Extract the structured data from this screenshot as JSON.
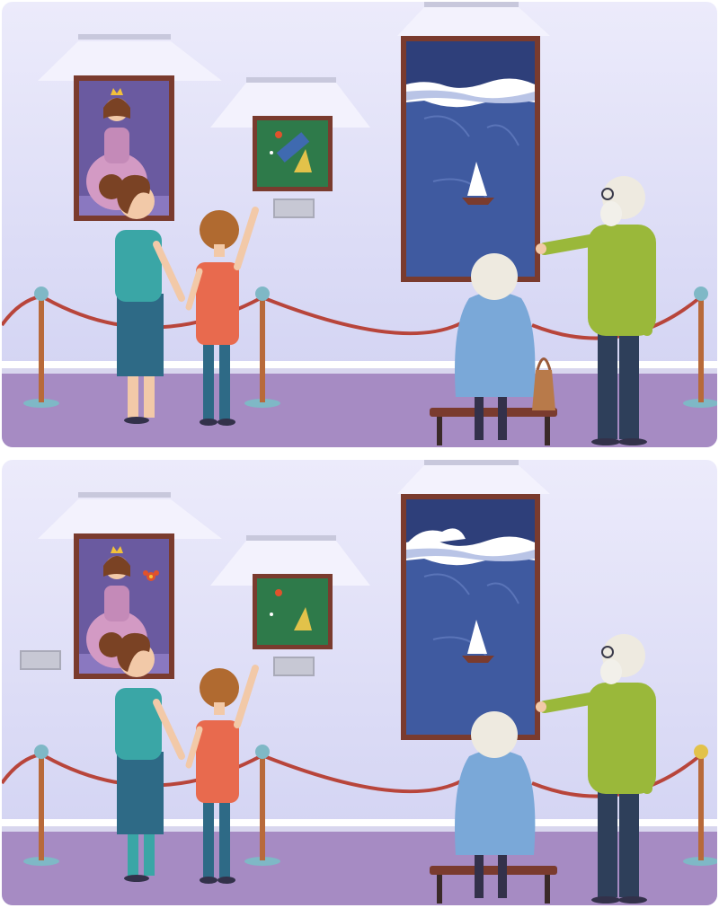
{
  "game": {
    "type": "spot-the-difference",
    "scene": "art-gallery",
    "panels": [
      {
        "id": "top",
        "role": "original"
      },
      {
        "id": "bottom",
        "role": "modified"
      }
    ]
  },
  "colors": {
    "wall": "#dcdcf6",
    "floor": "#a68bc3",
    "baseboard": "#ffffff",
    "rope": "#b8453b",
    "post": "#b86a3a",
    "post_knob": "#7fb8c6",
    "post_knob_gold": "#e2c24a",
    "sea_dark": "#2e3f7a",
    "sea": "#3f5aa0",
    "frame": "#7a3b2e"
  },
  "icons": [
    "spotlight-icon",
    "princess-painting-icon",
    "abstract-painting-icon",
    "sea-painting-icon",
    "sailboat-icon"
  ],
  "differences": [
    "princess-flower",
    "princess-painting-plaque",
    "abstract-blue-rectangle",
    "extra-wave",
    "handbag",
    "woman-legs",
    "right-post-knob-color"
  ]
}
